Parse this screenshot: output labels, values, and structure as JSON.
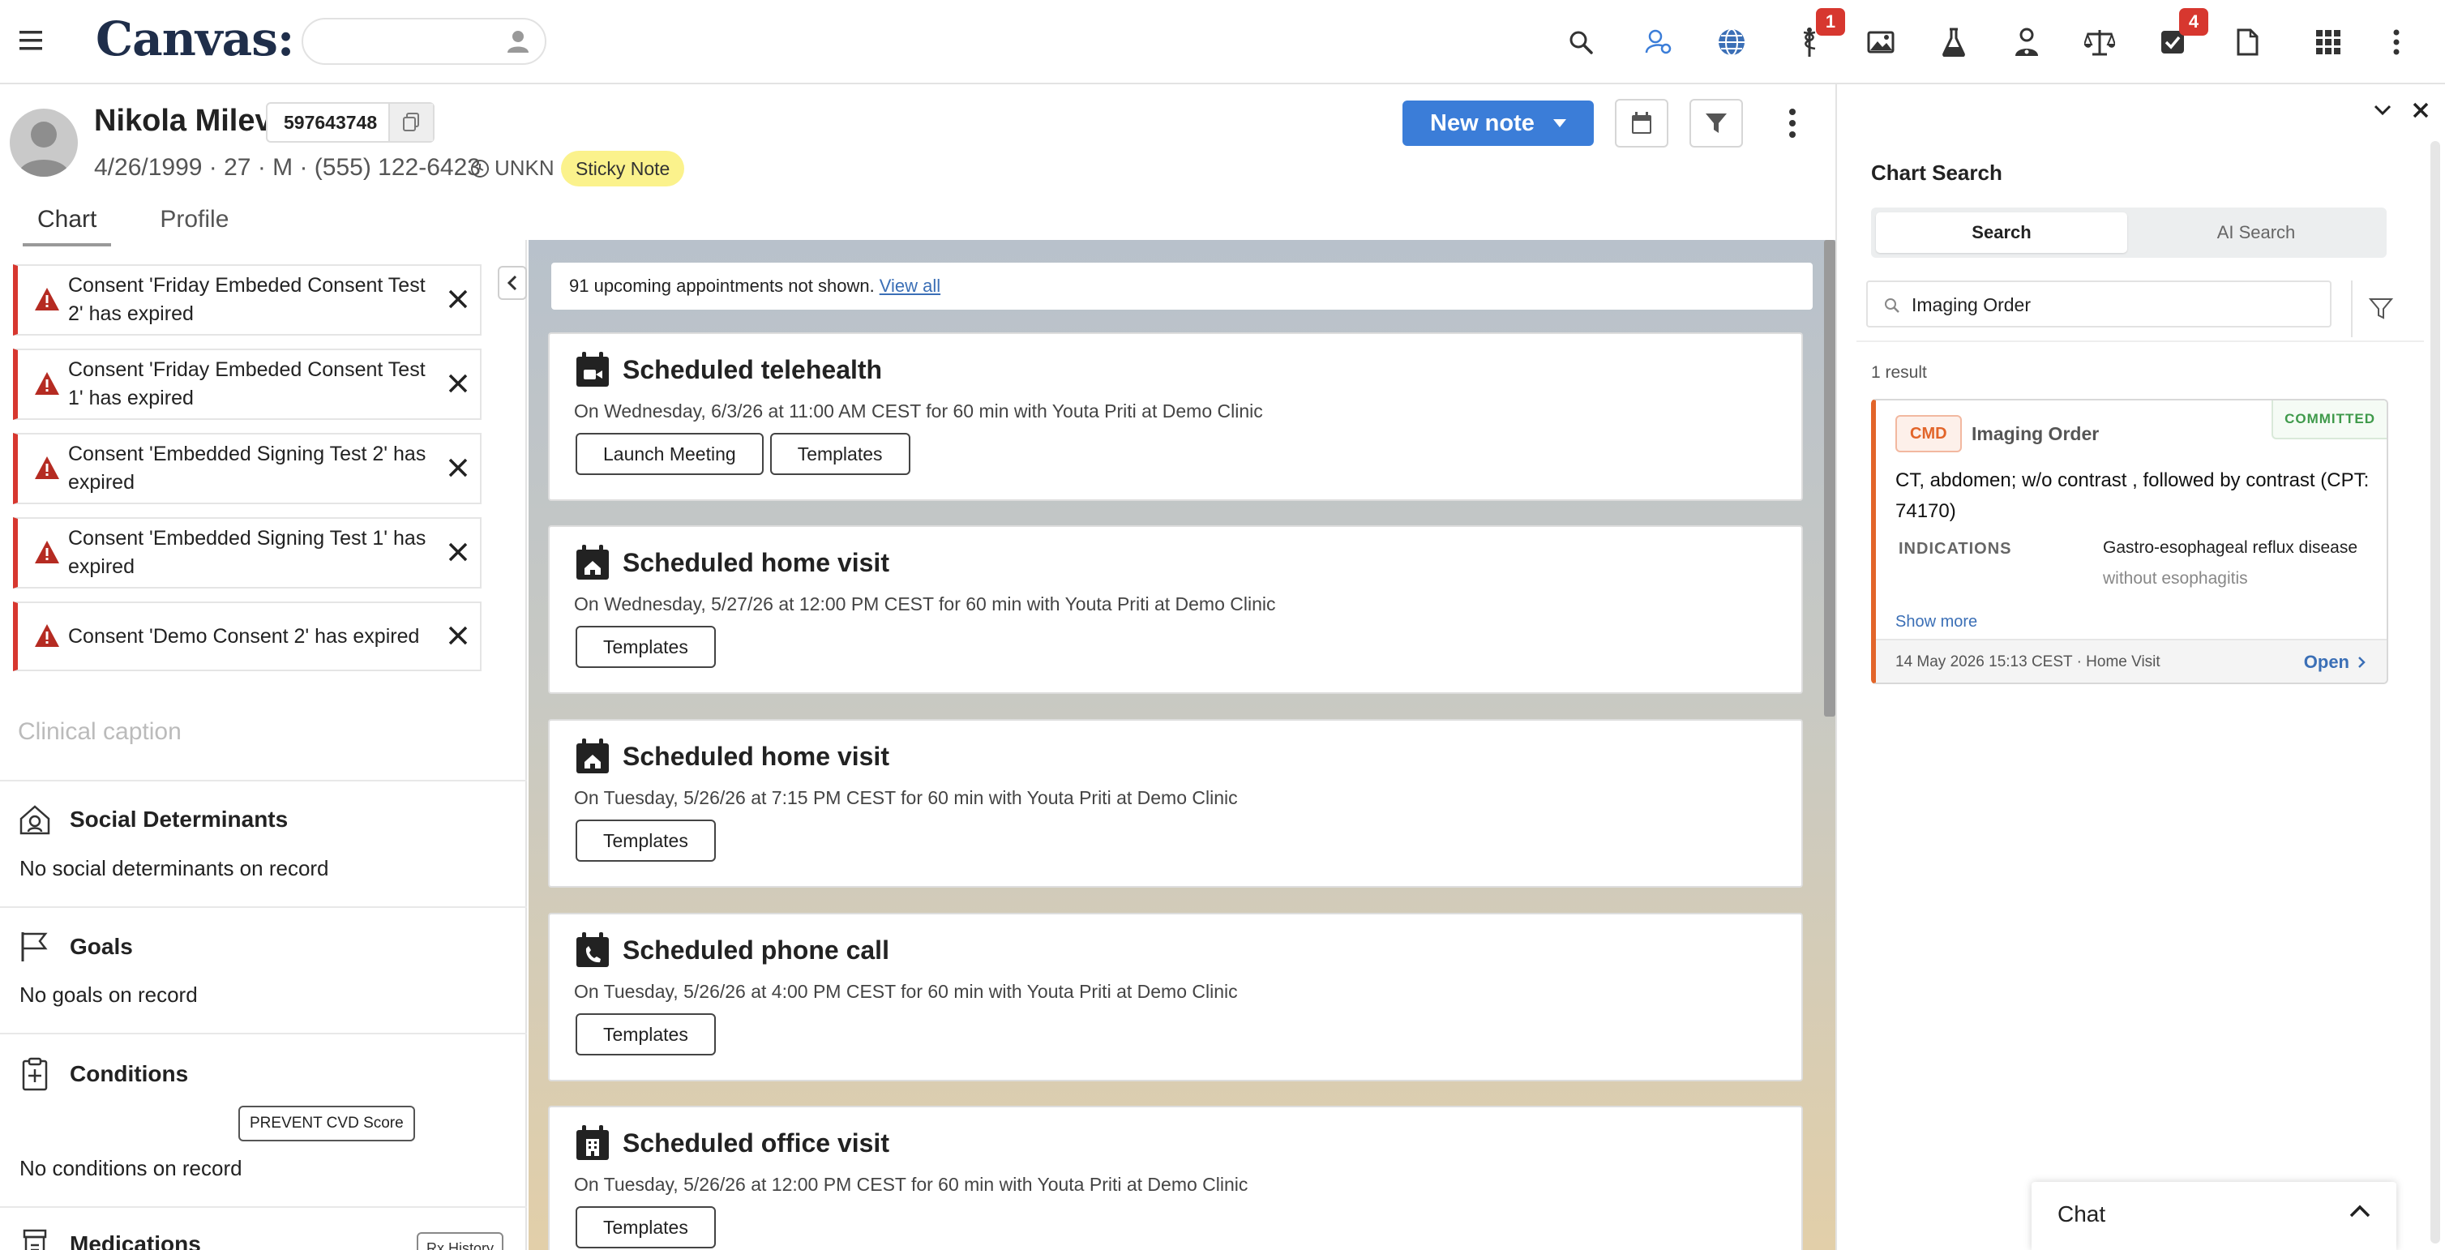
{
  "topbar": {
    "logo": "Canvas:",
    "patient_search_placeholder": "",
    "icons": [
      {
        "name": "search-icon"
      },
      {
        "name": "user-location-icon"
      },
      {
        "name": "globe-icon"
      },
      {
        "name": "caduceus-icon",
        "badge": "1"
      },
      {
        "name": "image-icon"
      },
      {
        "name": "flask-icon"
      },
      {
        "name": "doctor-icon"
      },
      {
        "name": "scale-icon"
      },
      {
        "name": "checkbox-icon",
        "badge": "4"
      },
      {
        "name": "document-icon"
      },
      {
        "name": "apps-grid-icon"
      },
      {
        "name": "more-vertical-icon"
      }
    ]
  },
  "patient": {
    "name": "Nikola Milev",
    "mrn": "597643748",
    "demographics": "4/26/1999 · 27 · M · (555) 122-6423",
    "timezone": "UNKN",
    "sticky_note": "Sticky Note"
  },
  "tabs": [
    {
      "label": "Chart",
      "active": true
    },
    {
      "label": "Profile",
      "active": false
    }
  ],
  "toolbar": {
    "new_note": "New note"
  },
  "alerts": [
    {
      "text": "Consent 'Friday Embeded Consent Test 2' has expired"
    },
    {
      "text": "Consent 'Friday Embeded Consent Test 1' has expired"
    },
    {
      "text": "Consent 'Embedded Signing Test 2' has expired"
    },
    {
      "text": "Consent 'Embedded Signing Test 1' has expired"
    },
    {
      "text": "Consent 'Demo Consent 2' has expired"
    }
  ],
  "left": {
    "caption_placeholder": "Clinical caption",
    "sections": {
      "social": {
        "title": "Social Determinants",
        "empty": "No social determinants on record"
      },
      "goals": {
        "title": "Goals",
        "empty": "No goals on record"
      },
      "conditions": {
        "title": "Conditions",
        "empty": "No conditions on record",
        "button": "PREVENT CVD Score"
      },
      "medications": {
        "title": "Medications",
        "button": "Rx History"
      }
    }
  },
  "timeline": {
    "banner_text": "91 upcoming appointments not shown.",
    "banner_link": "View all",
    "cards": [
      {
        "title": "Scheduled telehealth",
        "desc": "On Wednesday, 6/3/26 at 11:00 AM CEST for 60 min with Youta Priti at Demo Clinic",
        "buttons": [
          "Launch Meeting",
          "Templates"
        ],
        "icon": "calendar-video-icon"
      },
      {
        "title": "Scheduled home visit",
        "desc": "On Wednesday, 5/27/26 at 12:00 PM CEST for 60 min with Youta Priti at Demo Clinic",
        "buttons": [
          "Templates"
        ],
        "icon": "calendar-home-icon"
      },
      {
        "title": "Scheduled home visit",
        "desc": "On Tuesday, 5/26/26 at 7:15 PM CEST for 60 min with Youta Priti at Demo Clinic",
        "buttons": [
          "Templates"
        ],
        "icon": "calendar-home-icon"
      },
      {
        "title": "Scheduled phone call",
        "desc": "On Tuesday, 5/26/26 at 4:00 PM CEST for 60 min with Youta Priti at Demo Clinic",
        "buttons": [
          "Templates"
        ],
        "icon": "calendar-phone-icon"
      },
      {
        "title": "Scheduled office visit",
        "desc": "On Tuesday, 5/26/26 at 12:00 PM CEST for 60 min with Youta Priti at Demo Clinic",
        "buttons": [
          "Templates"
        ],
        "icon": "calendar-office-icon"
      }
    ]
  },
  "chart_search": {
    "title": "Chart Search",
    "tab_search": "Search",
    "tab_ai": "AI Search",
    "query": "Imaging Order",
    "result_count": "1 result",
    "result": {
      "tag": "CMD",
      "type": "Imaging Order",
      "status": "COMMITTED",
      "title": "CT, abdomen; w/o contrast , followed by contrast (CPT: 74170)",
      "indications_label": "INDICATIONS",
      "indication_line1": "Gastro-esophageal reflux disease",
      "indication_line2": "without esophagitis",
      "show_more": "Show more",
      "meta": "14 May 2026 15:13 CEST · Home Visit",
      "open": "Open"
    }
  },
  "chat": {
    "label": "Chat"
  },
  "colors": {
    "brand": "#1f2e4a",
    "primary": "#3b7dd8",
    "alert": "#d7372f",
    "cmd": "#e2652a",
    "committed": "#3f9a4b",
    "sticky": "#fbf28c"
  }
}
